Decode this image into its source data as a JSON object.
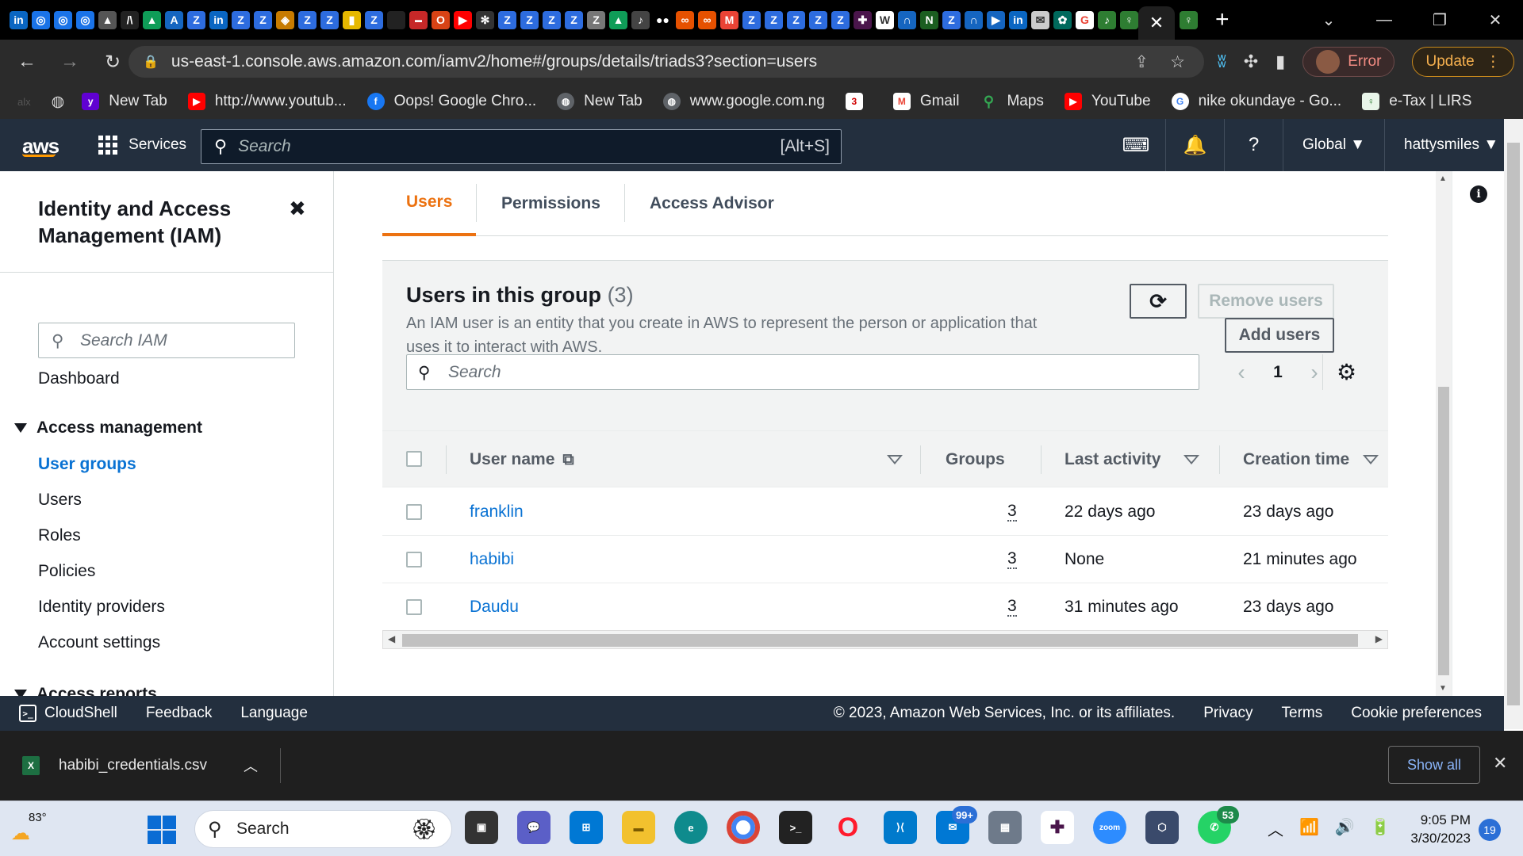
{
  "browser": {
    "active_tab_close": "✕",
    "new_tab": "+",
    "url": "us-east-1.console.aws.amazon.com/iamv2/home#/groups/details/triads3?section=users",
    "profile_status": "Error",
    "update_label": "Update",
    "bookmarks": [
      {
        "label": "New Tab",
        "icon": "yahoo-icon",
        "color": "#6001d2"
      },
      {
        "label": "http://www.youtub...",
        "icon": "youtube-icon",
        "color": "#ff0000"
      },
      {
        "label": "Oops! Google Chro...",
        "icon": "facebook-icon",
        "color": "#1877f2"
      },
      {
        "label": "New Tab",
        "icon": "globe-icon",
        "color": "#5f6368"
      },
      {
        "label": "www.google.com.ng",
        "icon": "globe-icon",
        "color": "#5f6368"
      },
      {
        "label": "",
        "icon": "channel3-icon",
        "color": "#d00000"
      },
      {
        "label": "Gmail",
        "icon": "gmail-icon",
        "color": "#ea4335"
      },
      {
        "label": "Maps",
        "icon": "maps-icon",
        "color": "#34a853"
      },
      {
        "label": "YouTube",
        "icon": "youtube-icon",
        "color": "#ff0000"
      },
      {
        "label": "nike okundaye - Go...",
        "icon": "google-icon",
        "color": "#4285f4"
      },
      {
        "label": "e-Tax | LIRS",
        "icon": "lirs-icon",
        "color": "#2e7d32"
      }
    ]
  },
  "aws_header": {
    "logo": "aws",
    "services": "Services",
    "search_placeholder": "Search",
    "search_shortcut": "[Alt+S]",
    "region": "Global ▼",
    "account": "hattysmiles ▼"
  },
  "sidebar": {
    "title": "Identity and Access Management (IAM)",
    "search_placeholder": "Search IAM",
    "dashboard": "Dashboard",
    "section_access_management": "Access management",
    "items": [
      "User groups",
      "Users",
      "Roles",
      "Policies",
      "Identity providers",
      "Account settings"
    ],
    "section_access_reports": "Access reports"
  },
  "tabs": [
    "Users",
    "Permissions",
    "Access Advisor"
  ],
  "users_panel": {
    "title": "Users in this group",
    "count": "(3)",
    "description": "An IAM user is an entity that you create in AWS to represent the person or application that uses it to interact with AWS.",
    "remove_button": "Remove users",
    "add_button": "Add users",
    "search_placeholder": "Search",
    "page": "1",
    "columns": [
      "User name",
      "Groups",
      "Last activity",
      "Creation time"
    ],
    "rows": [
      {
        "user": "franklin",
        "groups": "3",
        "last_activity": "22 days ago",
        "creation": "23 days ago"
      },
      {
        "user": "habibi",
        "groups": "3",
        "last_activity": "None",
        "creation": "21 minutes ago"
      },
      {
        "user": "Daudu",
        "groups": "3",
        "last_activity": "31 minutes ago",
        "creation": "23 days ago"
      }
    ]
  },
  "footer": {
    "cloudshell": "CloudShell",
    "feedback": "Feedback",
    "language": "Language",
    "copyright": "© 2023, Amazon Web Services, Inc. or its affiliates.",
    "privacy": "Privacy",
    "terms": "Terms",
    "cookies": "Cookie preferences"
  },
  "downloads": {
    "file": "habibi_credentials.csv",
    "show_all": "Show all"
  },
  "taskbar": {
    "temperature": "83°",
    "search_placeholder": "Search",
    "mail_badge": "99+",
    "whatsapp_badge": "53",
    "time": "9:05 PM",
    "date": "3/30/2023",
    "notifications": "19"
  }
}
